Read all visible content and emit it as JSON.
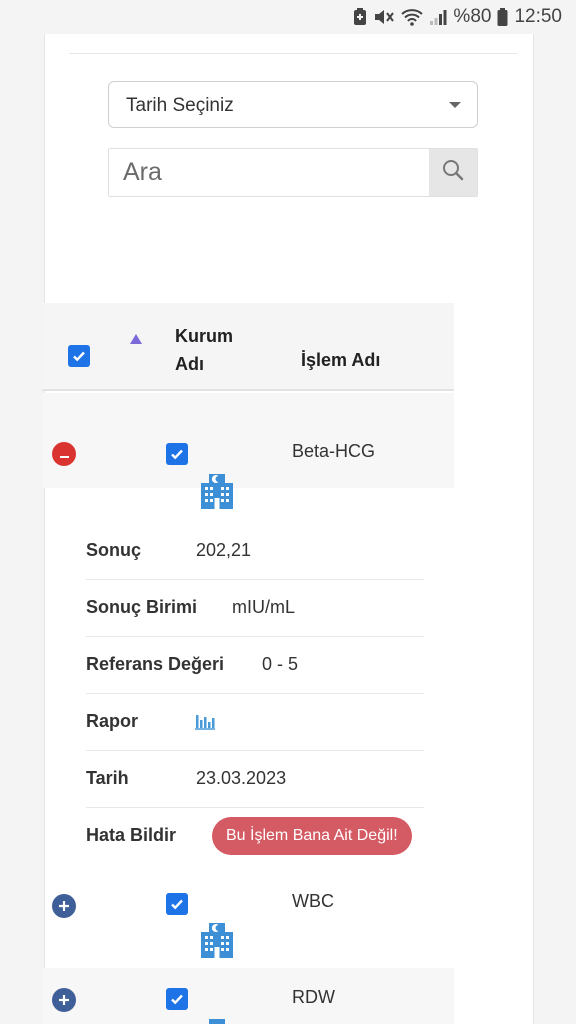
{
  "status_bar": {
    "battery_text": "%80",
    "time": "12:50"
  },
  "filter": {
    "date_select_label": "Tarih Seçiniz"
  },
  "search": {
    "placeholder": "Ara"
  },
  "table": {
    "header_institution": "Kurum Adı",
    "header_procedure": "İşlem Adı",
    "rows": [
      {
        "name": "Beta-HCG",
        "expanded": true,
        "details": {
          "result_label": "Sonuç",
          "result_value": "202,21",
          "unit_label": "Sonuç Birimi",
          "unit_value": "mIU/mL",
          "reference_label": "Referans Değeri",
          "reference_value": "0 - 5",
          "report_label": "Rapor",
          "date_label": "Tarih",
          "date_value": "23.03.2023",
          "error_label": "Hata Bildir",
          "error_button": "Bu İşlem Bana Ait Değil!"
        }
      },
      {
        "name": "WBC",
        "expanded": false
      },
      {
        "name": "RDW",
        "expanded": false
      }
    ]
  },
  "colors": {
    "checkbox": "#1e73e6",
    "collapse_button": "#d9342f",
    "expand_button": "#3f5f99",
    "error_button": "#d45a63",
    "hospital_icon": "#3d8fd6"
  }
}
